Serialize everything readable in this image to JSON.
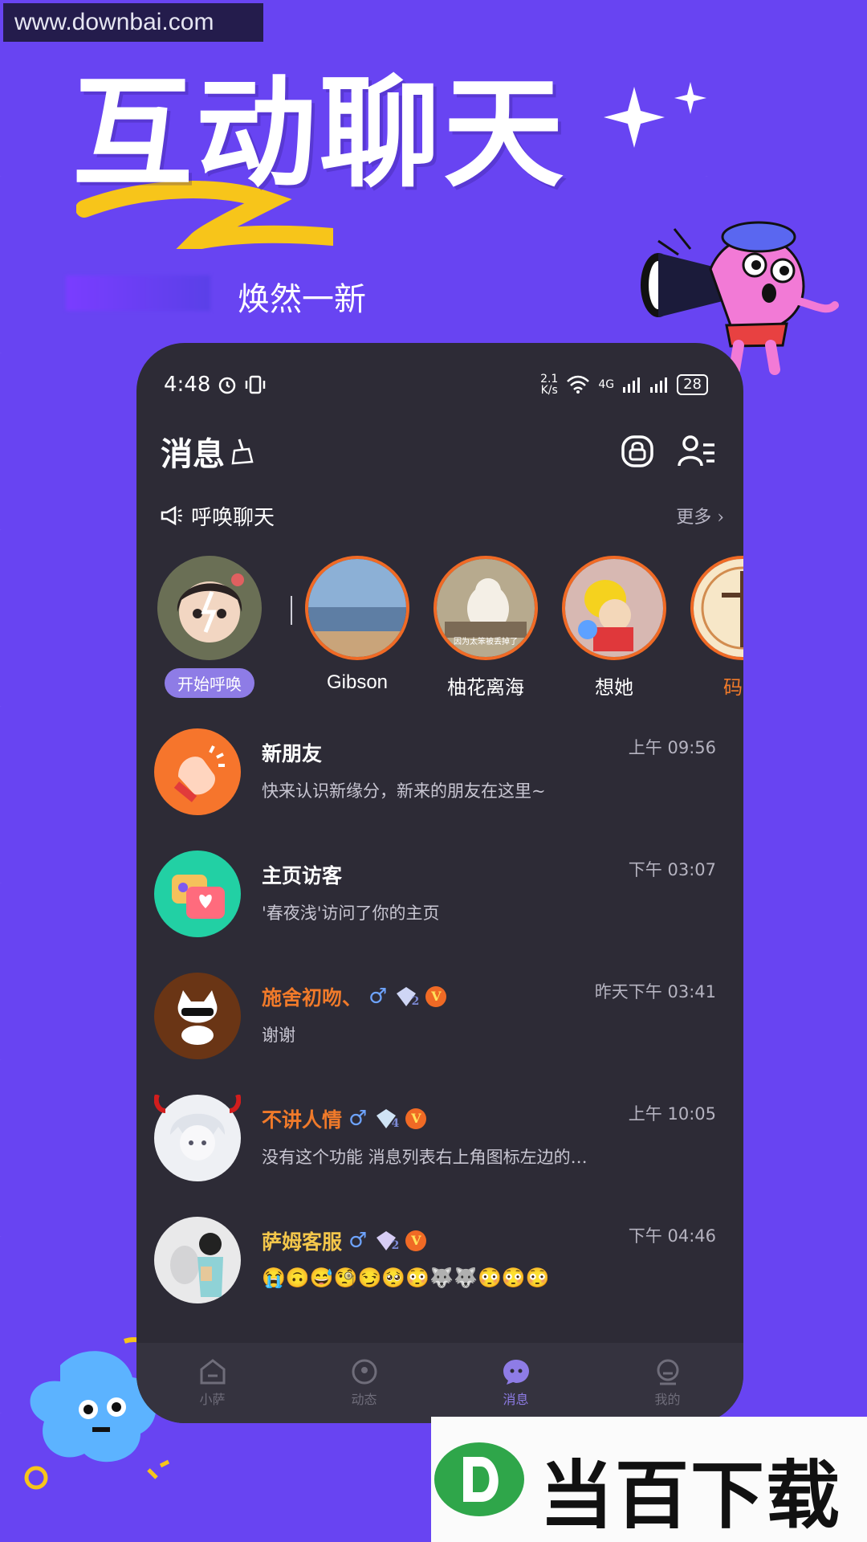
{
  "watermark": "www.downbai.com",
  "promo": {
    "headline": "互动聊天",
    "tagline": "焕然一新"
  },
  "status_bar": {
    "time": "4:48",
    "net_speed_top": "2.1",
    "net_speed_bottom": "K/s",
    "network": "4G",
    "battery": "28"
  },
  "header": {
    "title": "消息"
  },
  "summon": {
    "label": "呼唤聊天",
    "more": "更多 ›"
  },
  "stories": [
    {
      "name": "开始呼唤"
    },
    {
      "name": "Gibson"
    },
    {
      "name": "柚花离海",
      "caption": "因为太笨被丢掉了"
    },
    {
      "name": "想她"
    },
    {
      "name": "码字"
    }
  ],
  "conversations": [
    {
      "title": "新朋友",
      "message": "快来认识新缘分，新来的朋友在这里~",
      "time": "上午 09:56"
    },
    {
      "title": "主页访客",
      "message": "'春夜浅'访问了你的主页",
      "time": "下午 03:07"
    },
    {
      "title": "施舍初吻、",
      "message": "谢谢",
      "time": "昨天下午 03:41",
      "level": "2",
      "vip": "V"
    },
    {
      "title": "不讲人情",
      "message": "没有这个功能 消息列表右上角图标左边的…",
      "time": "上午 10:05",
      "level": "4",
      "vip": "V"
    },
    {
      "title": "萨姆客服",
      "message": "😭🙃😅🧐😏🥺😳🐺🐺😳😳😳",
      "time": "下午 04:46",
      "level": "2",
      "vip": "V"
    }
  ],
  "tabs": [
    {
      "label": "小萨"
    },
    {
      "label": "动态"
    },
    {
      "label": "消息",
      "active": true
    },
    {
      "label": "我的"
    }
  ],
  "logo": {
    "text": "当百下载"
  },
  "colors": {
    "background": "#6844f2",
    "phone": "#2d2b36",
    "accent_orange": "#f06a25",
    "accent_purple": "#8e7ce6",
    "name_orange": "#f07a2a",
    "name_gold": "#f3c64b"
  }
}
